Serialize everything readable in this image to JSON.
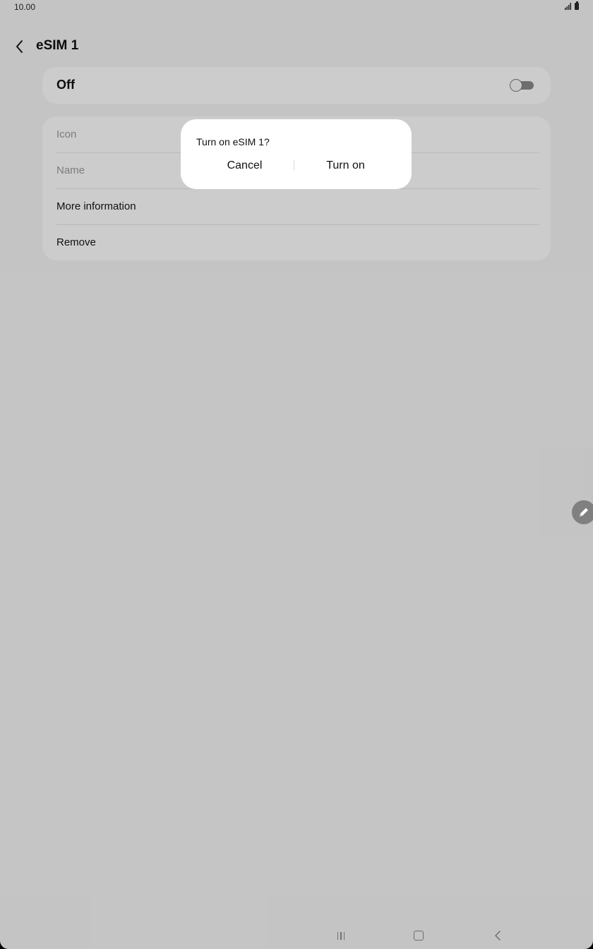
{
  "status_bar": {
    "time": "10.00"
  },
  "header": {
    "title": "eSIM 1"
  },
  "toggle": {
    "label": "Off",
    "state": "off"
  },
  "options": [
    {
      "label": "Icon",
      "enabled": false
    },
    {
      "label": "Name",
      "enabled": false
    },
    {
      "label": "More information",
      "enabled": true
    },
    {
      "label": "Remove",
      "enabled": true
    }
  ],
  "dialog": {
    "title": "Turn on eSIM 1?",
    "cancel_label": "Cancel",
    "confirm_label": "Turn on"
  },
  "colors": {
    "scrim": "#000000",
    "surface": "#ffffff",
    "background": "#f6f6f6"
  }
}
